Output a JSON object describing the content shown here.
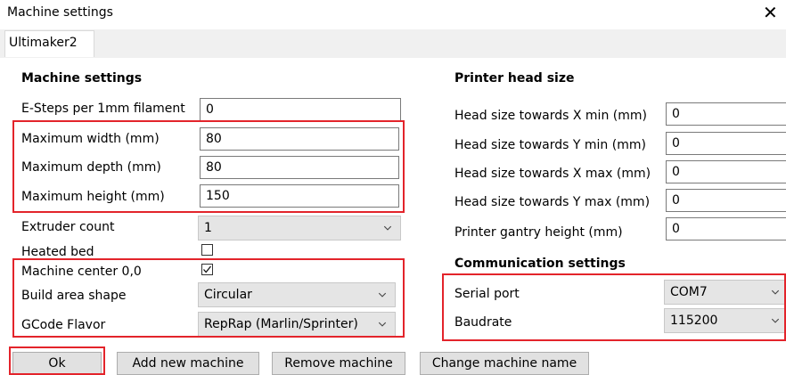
{
  "window": {
    "title": "Machine settings",
    "close_glyph": "✕"
  },
  "tabs": [
    {
      "label": "Ultimaker2"
    }
  ],
  "machine_settings": {
    "heading": "Machine settings",
    "esteps": {
      "label": "E-Steps per 1mm filament",
      "value": "0"
    },
    "max_width": {
      "label": "Maximum width (mm)",
      "value": "80"
    },
    "max_depth": {
      "label": "Maximum depth (mm)",
      "value": "80"
    },
    "max_height": {
      "label": "Maximum height (mm)",
      "value": "150"
    },
    "extruder_count": {
      "label": "Extruder count",
      "value": "1"
    },
    "heated_bed": {
      "label": "Heated bed",
      "checked": false
    },
    "machine_center": {
      "label": "Machine center 0,0",
      "checked": true
    },
    "build_area_shape": {
      "label": "Build area shape",
      "value": "Circular"
    },
    "gcode_flavor": {
      "label": "GCode Flavor",
      "value": "RepRap (Marlin/Sprinter)"
    }
  },
  "printer_head": {
    "heading": "Printer head size",
    "x_min": {
      "label": "Head size towards X min (mm)",
      "value": "0"
    },
    "y_min": {
      "label": "Head size towards Y min (mm)",
      "value": "0"
    },
    "x_max": {
      "label": "Head size towards X max (mm)",
      "value": "0"
    },
    "y_max": {
      "label": "Head size towards Y max (mm)",
      "value": "0"
    },
    "gantry": {
      "label": "Printer gantry height (mm)",
      "value": "0"
    }
  },
  "communication": {
    "heading": "Communication settings",
    "serial_port": {
      "label": "Serial port",
      "value": "COM7"
    },
    "baudrate": {
      "label": "Baudrate",
      "value": "115200"
    }
  },
  "buttons": {
    "ok": "Ok",
    "add_machine": "Add new machine",
    "remove_machine": "Remove machine",
    "change_name": "Change machine name"
  },
  "colors": {
    "highlight": "#e3242b",
    "tab_strip": "#f0f0f0",
    "select_bg": "#e5e5e5"
  }
}
